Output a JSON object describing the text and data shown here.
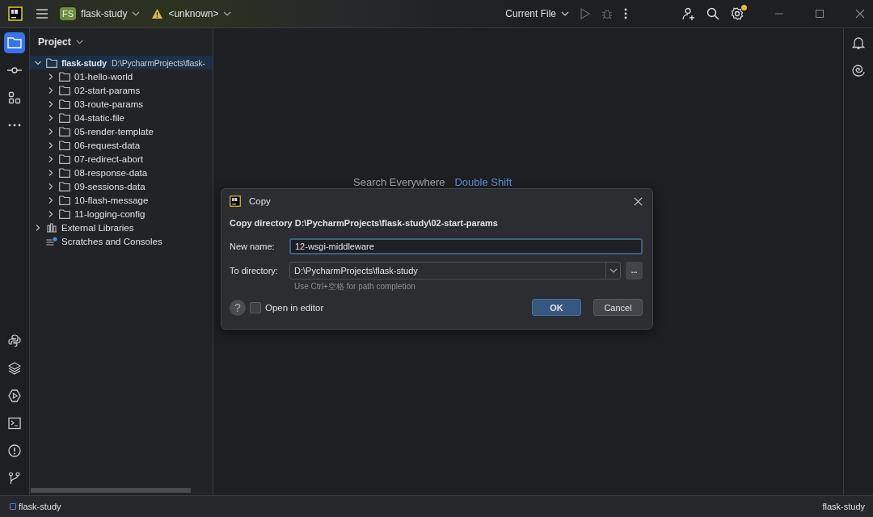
{
  "title_bar": {
    "project_badge": "FS",
    "project": "flask-study",
    "vcs": "<unknown>",
    "run_config": "Current File",
    "settings_badge": true
  },
  "left_tools": [
    {
      "kind": "folder",
      "selected": true
    },
    {
      "kind": "commit",
      "selected": false
    },
    {
      "kind": "structure",
      "selected": false
    },
    {
      "kind": "more",
      "selected": false
    }
  ],
  "left_tools_bottom": [
    {
      "kind": "python",
      "selected": false
    },
    {
      "kind": "layers",
      "selected": false
    },
    {
      "kind": "services",
      "selected": false
    },
    {
      "kind": "terminal",
      "selected": false
    },
    {
      "kind": "problems",
      "selected": false
    },
    {
      "kind": "git",
      "selected": false
    }
  ],
  "right_tools": [
    {
      "kind": "bell"
    },
    {
      "kind": "spiral"
    }
  ],
  "project_panel": {
    "title": "Project",
    "tree": [
      {
        "kind": "folder",
        "label": "flask-study",
        "path": "D:\\PycharmProjects\\flask-",
        "expanded": true,
        "selected": true,
        "children": [
          {
            "label": "01-hello-world",
            "expanded": false,
            "selected": false
          },
          {
            "label": "02-start-params",
            "expanded": false,
            "selected": false
          },
          {
            "label": "03-route-params",
            "expanded": false,
            "selected": false
          },
          {
            "label": "04-static-file",
            "expanded": false,
            "selected": false
          },
          {
            "label": "05-render-template",
            "expanded": false,
            "selected": false
          },
          {
            "label": "06-request-data",
            "expanded": false,
            "selected": false
          },
          {
            "label": "07-redirect-abort",
            "expanded": false,
            "selected": false
          },
          {
            "label": "08-response-data",
            "expanded": false,
            "selected": false
          },
          {
            "label": "09-sessions-data",
            "expanded": false,
            "selected": false
          },
          {
            "label": "10-flash-message",
            "expanded": false,
            "selected": false
          },
          {
            "label": "11-logging-config",
            "expanded": false,
            "selected": false
          }
        ]
      },
      {
        "kind": "library",
        "label": "External Libraries",
        "expanded": false,
        "selected": false
      },
      {
        "kind": "scratches",
        "label": "Scratches and Consoles",
        "selected": false
      }
    ]
  },
  "editor_hint": {
    "action": "Search Everywhere",
    "shortcut": "Double Shift"
  },
  "dialog": {
    "title": "Copy",
    "heading": "Copy directory D:\\PycharmProjects\\flask-study\\02-start-params",
    "new_name_label": "New name:",
    "new_name": "12-wsgi-middleware",
    "to_directory_label": "To directory:",
    "to_directory": "D:\\PycharmProjects\\flask-study",
    "browse": "...",
    "hint": "Use Ctrl+空格 for path completion",
    "help": "?",
    "open_in_editor": {
      "label": "Open in editor",
      "checked": false
    },
    "buttons": [
      {
        "label": "OK",
        "kind": "primary"
      },
      {
        "label": "Cancel",
        "kind": "secondary"
      }
    ]
  },
  "status_bar": {
    "left": "flask-study",
    "right": "flask-study"
  }
}
